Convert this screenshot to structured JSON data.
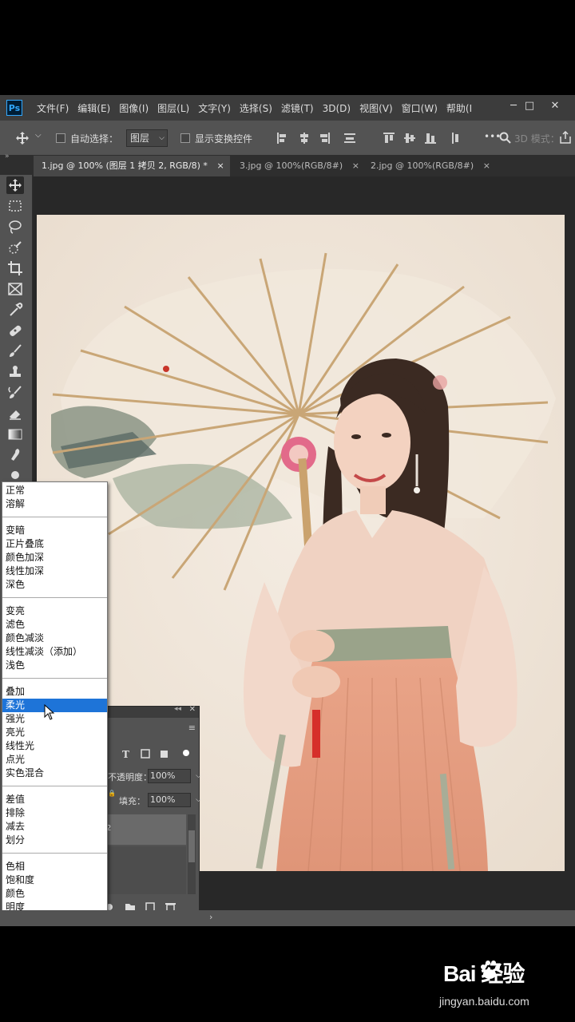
{
  "app": {
    "logo_text": "Ps"
  },
  "menu": [
    "文件(F)",
    "编辑(E)",
    "图像(I)",
    "图层(L)",
    "文字(Y)",
    "选择(S)",
    "滤镜(T)",
    "3D(D)",
    "视图(V)",
    "窗口(W)",
    "帮助(I"
  ],
  "window_controls": {
    "minimize": "─",
    "maximize": "□",
    "close": "✕"
  },
  "options": {
    "auto_select_label": "自动选择：",
    "auto_select_value": "图层",
    "show_transform_label": "显示变换控件",
    "mode_3d_label": "3D 模式：",
    "more": "•••"
  },
  "tabs": [
    {
      "label": "1.jpg @ 100% (图层 1 拷贝 2, RGB/8) *",
      "close": "×",
      "active": true
    },
    {
      "label": "3.jpg @ 100%(RGB/8#)",
      "close": "×",
      "active": false
    },
    {
      "label": "2.jpg @ 100%(RGB/8#)",
      "close": "×",
      "active": false
    }
  ],
  "blend_modes": {
    "groups": [
      [
        "正常",
        "溶解"
      ],
      [
        "变暗",
        "正片叠底",
        "颜色加深",
        "线性加深",
        "深色"
      ],
      [
        "变亮",
        "滤色",
        "颜色减淡",
        "线性减淡（添加）",
        "浅色"
      ],
      [
        "叠加",
        "柔光",
        "强光",
        "亮光",
        "线性光",
        "点光",
        "实色混合"
      ],
      [
        "差值",
        "排除",
        "减去",
        "划分"
      ],
      [
        "色相",
        "饱和度",
        "颜色",
        "明度"
      ]
    ],
    "highlighted": "柔光"
  },
  "layers_panel": {
    "opacity_label": "不透明度：",
    "opacity_value": "100%",
    "fill_label": "填充：",
    "fill_value": "100%",
    "layer_suffix": "2"
  },
  "watermark": {
    "logo": "Bai  经验",
    "url": "jingyan.baidu.com"
  },
  "colors": {
    "highlight": "#1e74d8",
    "ps_accent": "#31a8ff",
    "ui_bg": "#535353"
  }
}
